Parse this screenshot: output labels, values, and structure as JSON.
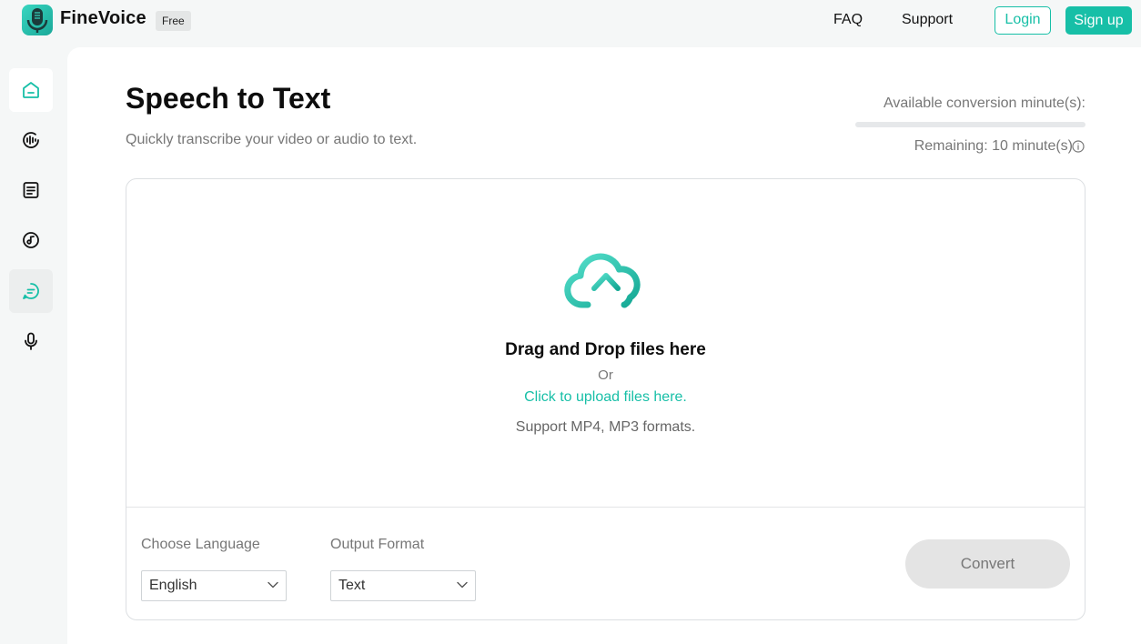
{
  "header": {
    "brand": "FineVoice",
    "badge": "Free",
    "nav": {
      "faq": "FAQ",
      "support": "Support"
    },
    "login_label": "Login",
    "signup_label": "Sign up"
  },
  "sidebar": {
    "items": [
      {
        "icon": "home-icon",
        "state": "active"
      },
      {
        "icon": "voice-changer-icon",
        "state": "normal"
      },
      {
        "icon": "document-icon",
        "state": "normal"
      },
      {
        "icon": "music-icon",
        "state": "normal"
      },
      {
        "icon": "speech-bubble-icon",
        "state": "selected"
      },
      {
        "icon": "microphone-icon",
        "state": "normal"
      }
    ]
  },
  "main": {
    "title": "Speech to Text",
    "subtitle": "Quickly transcribe your video or audio to text.",
    "quota": {
      "label": "Available conversion minute(s):",
      "remaining": "Remaining: 10 minute(s)",
      "used_fraction": 0
    },
    "upload": {
      "icon": "cloud-upload-icon",
      "title": "Drag and Drop files here",
      "or": "Or",
      "link": "Click to upload files here.",
      "support": "Support MP4, MP3 formats."
    },
    "language": {
      "label": "Choose Language",
      "value": "English"
    },
    "format": {
      "label": "Output Format",
      "value": "Text"
    },
    "convert_label": "Convert"
  },
  "colors": {
    "accent": "#17bfa7",
    "disabled": "#e4e4e4"
  }
}
